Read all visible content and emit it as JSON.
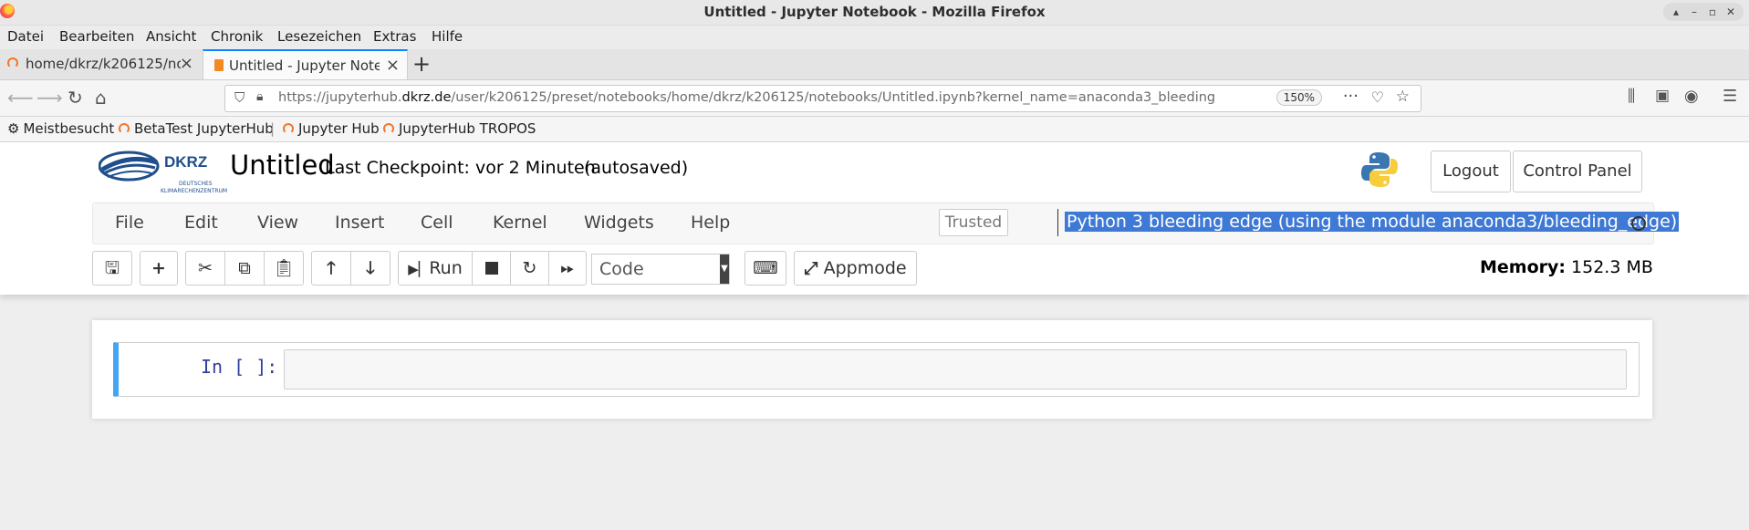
{
  "window": {
    "title": "Untitled - Jupyter Notebook - Mozilla Firefox"
  },
  "menu": [
    "Datei",
    "Bearbeiten",
    "Ansicht",
    "Chronik",
    "Lesezeichen",
    "Extras",
    "Hilfe"
  ],
  "tabs": [
    {
      "label": "home/dkrz/k206125/not"
    },
    {
      "label": "Untitled - Jupyter Notebo"
    }
  ],
  "url": {
    "prefix": "https://jupyterhub.",
    "domain": "dkrz.de",
    "rest": "/user/k206125/preset/notebooks/home/dkrz/k206125/notebooks/Untitled.ipynb?kernel_name=anaconda3_bleeding"
  },
  "zoom": "150%",
  "bookmarks": [
    "Meistbesucht",
    "BetaTest JupyterHub",
    "Jupyter Hub",
    "JupyterHub TROPOS"
  ],
  "jupyter": {
    "logo_text": "DKRZ",
    "logo_sub1": "DEUTSCHES",
    "logo_sub2": "KLIMARECHENZENTRUM",
    "notebook_title": "Untitled",
    "checkpoint": "Last Checkpoint: vor 2 Minuten",
    "autosaved": "(autosaved)",
    "logout": "Logout",
    "control_panel": "Control Panel",
    "menu": [
      "File",
      "Edit",
      "View",
      "Insert",
      "Cell",
      "Kernel",
      "Widgets",
      "Help"
    ],
    "trusted": "Trusted",
    "kernel": "Python 3 bleeding edge (using the module anaconda3/bleeding_edge)",
    "run_label": "Run",
    "cell_type": "Code",
    "appmode_label": "Appmode",
    "memory_label": "Memory:",
    "memory_value": "152.3 MB",
    "cell_prompt": "In [ ]:"
  }
}
